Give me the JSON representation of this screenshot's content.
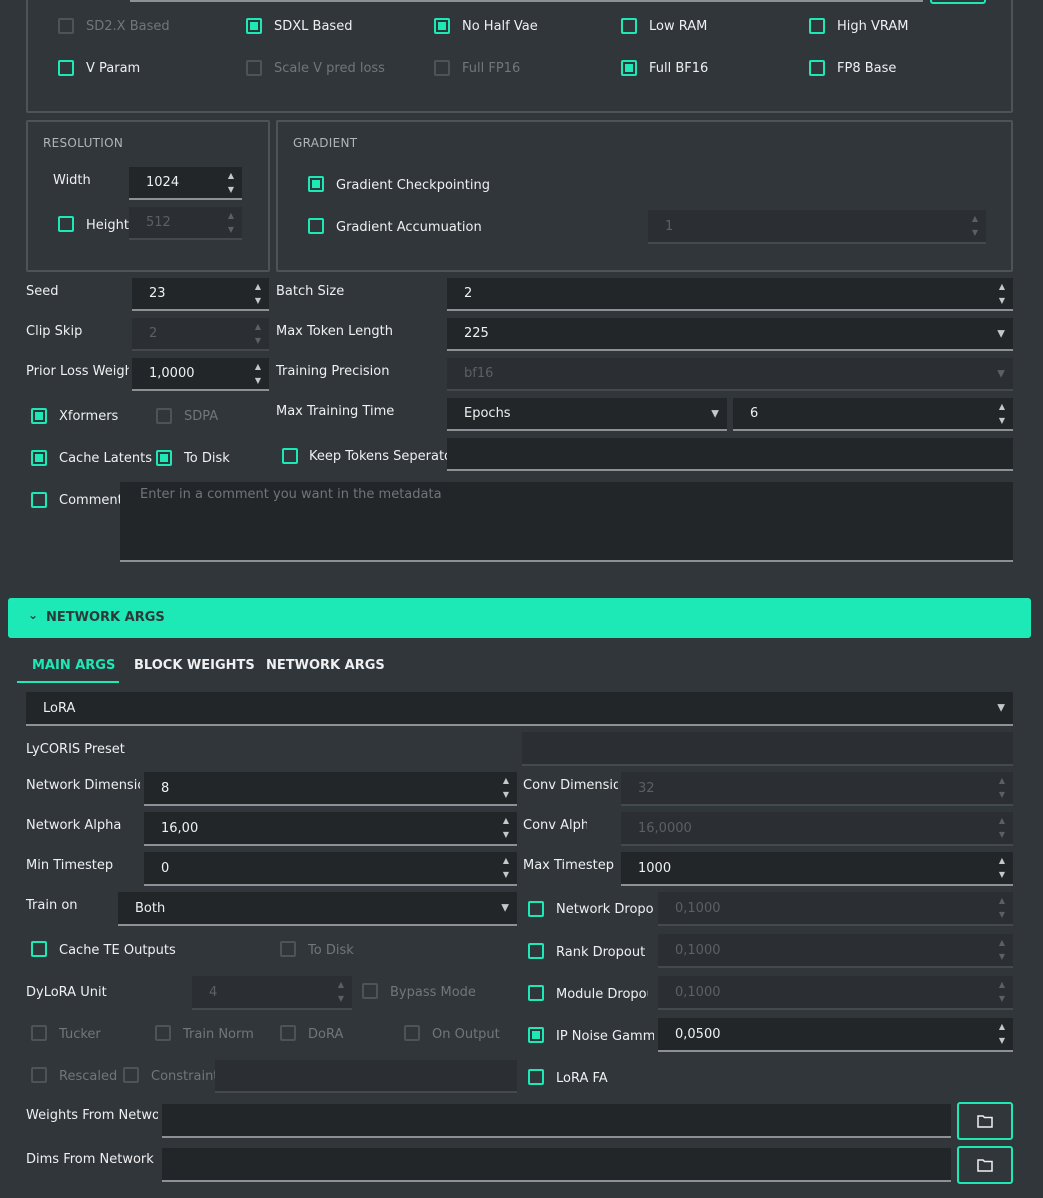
{
  "flags": {
    "sd2x": "SD2.X Based",
    "sdxl": "SDXL Based",
    "no_half_vae": "No Half Vae",
    "low_ram": "Low RAM",
    "high_vram": "High VRAM",
    "v_param": "V Param",
    "scale_v": "Scale V pred loss",
    "full_fp16": "Full FP16",
    "full_bf16": "Full BF16",
    "fp8_base": "FP8 Base"
  },
  "resolution": {
    "title": "RESOLUTION",
    "width_label": "Width",
    "width": "1024",
    "height_label": "Height",
    "height": "512"
  },
  "gradient": {
    "title": "GRADIENT",
    "checkpointing": "Gradient Checkpointing",
    "accumulation": "Gradient Accumuation",
    "accumulation_value": "1"
  },
  "training": {
    "seed_label": "Seed",
    "seed": "23",
    "clip_skip_label": "Clip Skip",
    "clip_skip": "2",
    "prior_loss_label": "Prior Loss Weight",
    "prior_loss": "1,0000",
    "xformers": "Xformers",
    "sdpa": "SDPA",
    "cache_latents": "Cache Latents",
    "to_disk": "To Disk",
    "comment": "Comment",
    "comment_placeholder": "Enter in a comment you want in the metadata",
    "batch_size_label": "Batch Size",
    "batch_size": "2",
    "max_token_label": "Max Token Length",
    "max_token": "225",
    "precision_label": "Training Precision",
    "precision": "bf16",
    "max_time_label": "Max Training Time",
    "max_time_unit": "Epochs",
    "max_time": "6",
    "keep_tokens_sep": "Keep Tokens Seperator"
  },
  "network_header": "NETWORK ARGS",
  "tabs": [
    "MAIN ARGS",
    "BLOCK WEIGHTS",
    "NETWORK ARGS"
  ],
  "network": {
    "type": "LoRA",
    "lycoris_preset_label": "LyCORIS Preset",
    "net_dim_label": "Network Dimension",
    "net_dim": "8",
    "conv_dim_label": "Conv Dimension",
    "conv_dim": "32",
    "net_alpha_label": "Network Alpha",
    "net_alpha": "16,00",
    "conv_alpha_label": "Conv Alpha",
    "conv_alpha": "16,0000",
    "min_ts_label": "Min Timestep",
    "min_ts": "0",
    "max_ts_label": "Max Timestep",
    "max_ts": "1000",
    "train_on_label": "Train on",
    "train_on": "Both",
    "net_dropout": "Network Dropout",
    "net_dropout_val": "0,1000",
    "cache_te": "Cache TE Outputs",
    "te_to_disk": "To Disk",
    "rank_dropout": "Rank Dropout",
    "rank_dropout_val": "0,1000",
    "dylora_label": "DyLoRA Unit",
    "dylora": "4",
    "bypass": "Bypass Mode",
    "module_dropout": "Module Dropout",
    "module_dropout_val": "0,1000",
    "tucker": "Tucker",
    "train_norm": "Train Norm",
    "dora": "DoRA",
    "on_output": "On Output",
    "ip_noise": "IP Noise Gamma",
    "ip_noise_val": "0,0500",
    "rescaled": "Rescaled",
    "constraint": "Constraint",
    "lora_fa": "LoRA FA",
    "weights_from_label": "Weights From Network",
    "dims_from_label": "Dims From Network"
  },
  "colors": {
    "accent": "#1de9b6",
    "background": "#31363b",
    "input": "#232629"
  }
}
